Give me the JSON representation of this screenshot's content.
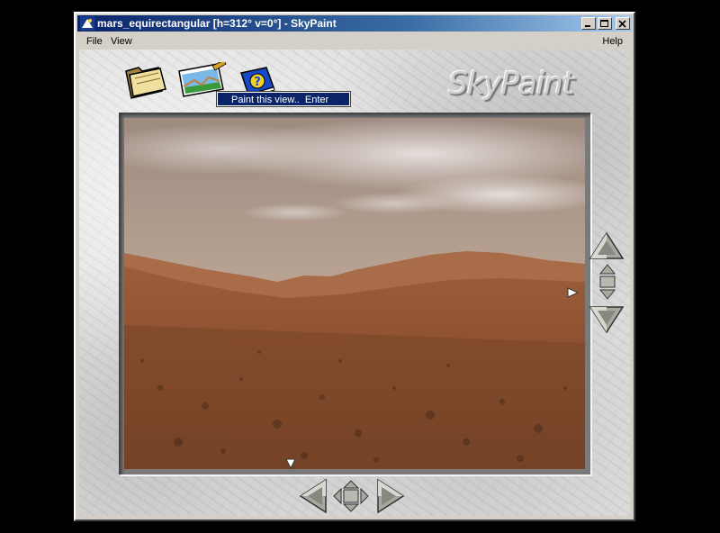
{
  "window": {
    "title": "mars_equirectangular [h=312° v=0°] - SkyPaint"
  },
  "menu": {
    "file": "File",
    "view": "View",
    "help": "Help"
  },
  "brand": {
    "logo_text": "SkyPaint"
  },
  "toolbar": {
    "icons": [
      "open-folder-icon",
      "paint-view-icon",
      "help-book-icon"
    ]
  },
  "tooltip": {
    "text": "Paint this view..  Enter"
  },
  "view": {
    "heading_deg": 312,
    "pitch_deg": 0
  },
  "colors": {
    "title_start": "#0a246a",
    "title_end": "#a6caf0",
    "sky": "#b8a395",
    "ground": "#8a5030"
  }
}
